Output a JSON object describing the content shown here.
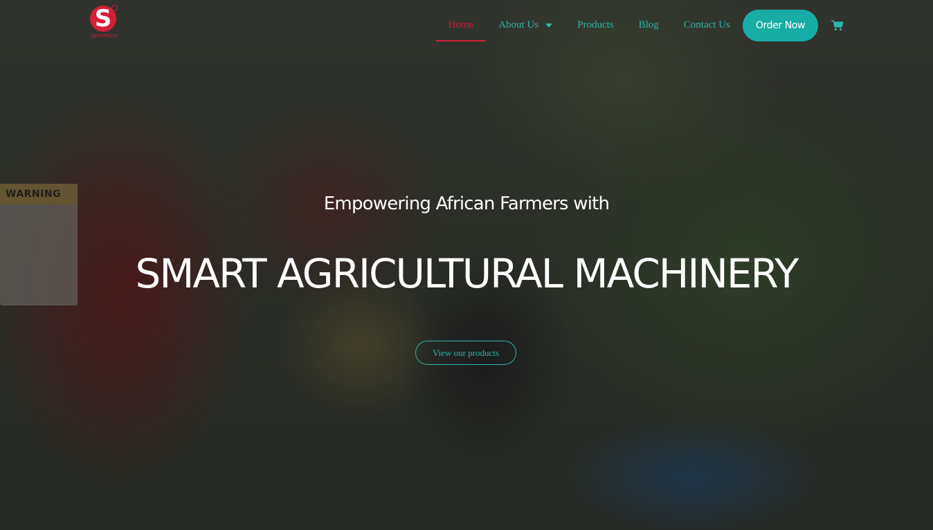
{
  "brand": {
    "logo_letter": "S",
    "logo_text": "SAYeTECH",
    "accent": "#17ada6",
    "brand_red": "#d51f37"
  },
  "nav": {
    "items": [
      {
        "label": "Home",
        "active": true
      },
      {
        "label": "About Us",
        "has_dropdown": true
      },
      {
        "label": "Products"
      },
      {
        "label": "Blog"
      },
      {
        "label": "Contact Us"
      }
    ],
    "order_button": "Order Now",
    "cart_icon": "shopping-cart-icon"
  },
  "hero": {
    "tagline": "Empowering African Farmers with",
    "headline": "SMART AGRICULTURAL MACHINERY",
    "cta": "View our products",
    "warning_label": "WARNING"
  }
}
